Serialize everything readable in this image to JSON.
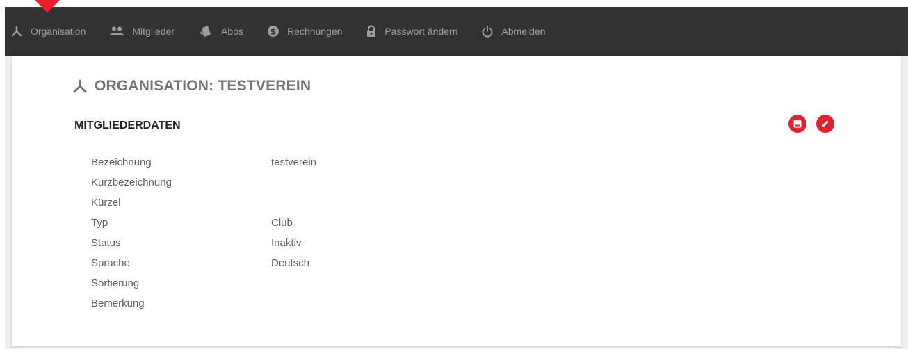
{
  "nav": {
    "items": [
      {
        "label": "Organisation",
        "icon": "organisation-icon"
      },
      {
        "label": "Mitglieder",
        "icon": "members-icon"
      },
      {
        "label": "Abos",
        "icon": "cards-icon"
      },
      {
        "label": "Rechnungen",
        "icon": "dollar-icon"
      },
      {
        "label": "Passwort ändern",
        "icon": "lock-icon"
      },
      {
        "label": "Abmelden",
        "icon": "power-icon"
      }
    ]
  },
  "page": {
    "title": "ORGANISATION: TESTVEREIN",
    "section_title": "MITGLIEDERDATEN"
  },
  "actions": {
    "save_icon": "save-icon",
    "edit_icon": "pencil-icon"
  },
  "fields": [
    {
      "label": "Bezeichnung",
      "value": "testverein"
    },
    {
      "label": "Kurzbezeichnung",
      "value": ""
    },
    {
      "label": "Kürzel",
      "value": ""
    },
    {
      "label": "Typ",
      "value": "Club"
    },
    {
      "label": "Status",
      "value": "Inaktiv"
    },
    {
      "label": "Sprache",
      "value": "Deutsch"
    },
    {
      "label": "Sortierung",
      "value": ""
    },
    {
      "label": "Bemerkung",
      "value": ""
    }
  ],
  "colors": {
    "navbar": "#323232",
    "nav_text": "#9e9e9e",
    "accent": "#e8202e",
    "title": "#757575"
  }
}
